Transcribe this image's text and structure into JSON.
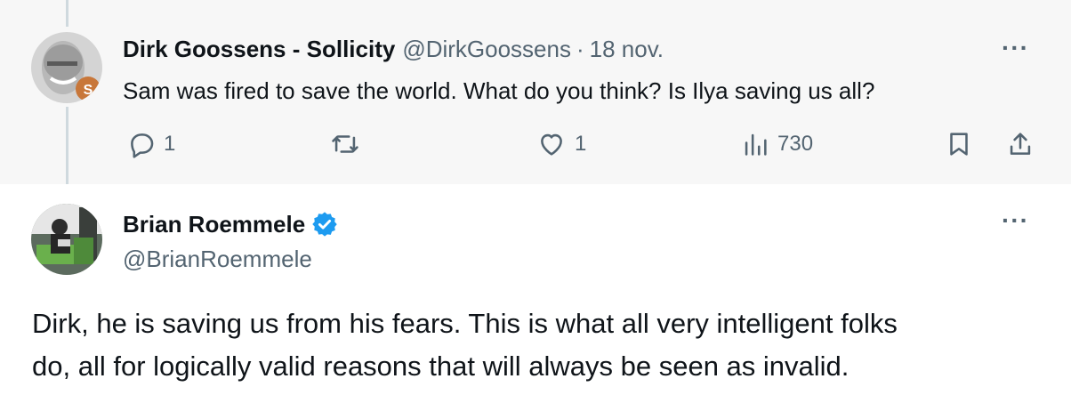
{
  "parent_tweet": {
    "display_name": "Dirk Goossens - Sollicity",
    "handle": "@DirkGoossens",
    "separator": "·",
    "date": "18 nov.",
    "text": "Sam was fired to save the world. What do you think? Is Ilya saving us all?",
    "more_label": "···",
    "actions": {
      "reply_count": "1",
      "like_count": "1",
      "views_count": "730"
    }
  },
  "reply_tweet": {
    "display_name": "Brian Roemmele",
    "handle": "@BrianRoemmele",
    "more_label": "···",
    "text_lines": [
      "Dirk, he is saving us from his fears. This is what all very intelligent folks",
      "do, all for logically valid reasons that will always be seen as invalid."
    ]
  },
  "colors": {
    "parent_background": "#f7f7f7",
    "verified_badge": "#1d9bf0",
    "secondary_text": "#536471",
    "primary_text": "#0f1419"
  }
}
